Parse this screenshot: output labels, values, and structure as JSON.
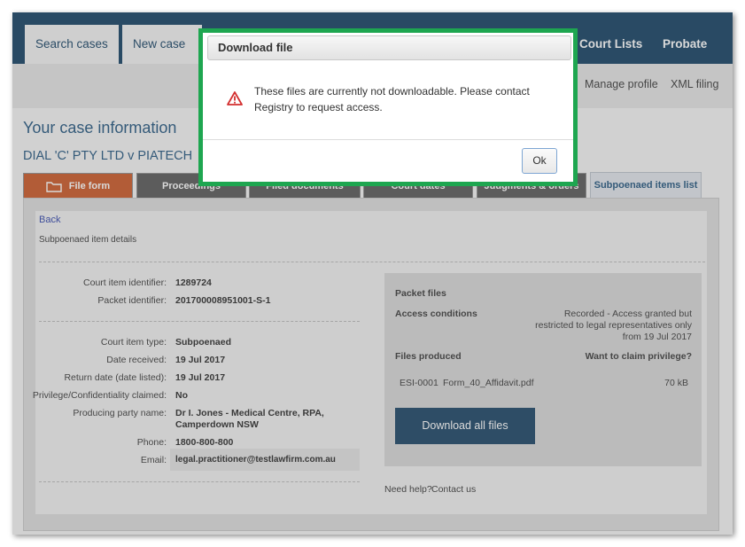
{
  "nav": {
    "tabs": [
      "Search cases",
      "New case",
      "Court Lists",
      "Probate"
    ],
    "sub_links": [
      "Manage profile",
      "XML filing"
    ]
  },
  "case": {
    "heading": "Your case information",
    "name": "DIAL 'C' PTY LTD v PIATECH"
  },
  "tabs": [
    "File form",
    "Proceedings",
    "Filed documents",
    "Court dates",
    "Judgments & orders",
    "Subpoenaed items list"
  ],
  "detail": {
    "back": "Back",
    "subtitle": "Subpoenaed item details",
    "rows_top": [
      {
        "label": "Court item identifier:",
        "value": "1289724"
      },
      {
        "label": "Packet identifier:",
        "value": "201700008951001-S-1"
      }
    ],
    "rows_bottom": [
      {
        "label": "Court item type:",
        "value": "Subpoenaed"
      },
      {
        "label": "Date received:",
        "value": "19 Jul 2017"
      },
      {
        "label": "Return date (date listed):",
        "value": "19 Jul 2017"
      },
      {
        "label": "Privilege/Confidentiality claimed:",
        "value": "No"
      },
      {
        "label": "Producing party name:",
        "value": "Dr I. Jones - Medical Centre, RPA, Camperdown NSW"
      },
      {
        "label": "Phone:",
        "value": "1800-800-800"
      },
      {
        "label": "Email:",
        "value": "legal.practitioner@testlawfirm.com.au"
      }
    ],
    "producing_line1": "Dr I. Jones - Medical Centre, RPA,",
    "producing_line2": "Camperdown NSW"
  },
  "packet": {
    "heading": "Packet files",
    "access_label": "Access conditions",
    "access_line1": "Recorded - Access granted but",
    "access_line2": "restricted to legal representatives only",
    "access_line3": "from 19 Jul 2017",
    "files_label": "Files produced",
    "privilege_link": "Want to claim privilege?",
    "file_id": "ESI-0001",
    "file_name": "Form_40_Affidavit.pdf",
    "file_size": "70 kB",
    "download_all": "Download all files",
    "help_text": "Need help?",
    "contact_link": "Contact us"
  },
  "dialog": {
    "title": "Download file",
    "message": "These files are currently not downloadable. Please contact Registry to request access.",
    "ok_label": "Ok"
  },
  "colors": {
    "nav_dark": "#0c3a5e",
    "tab_orange": "#c9531f",
    "dialog_border": "#1ea650",
    "warning_red": "#d32f2f",
    "link": "#2a3fa8"
  }
}
